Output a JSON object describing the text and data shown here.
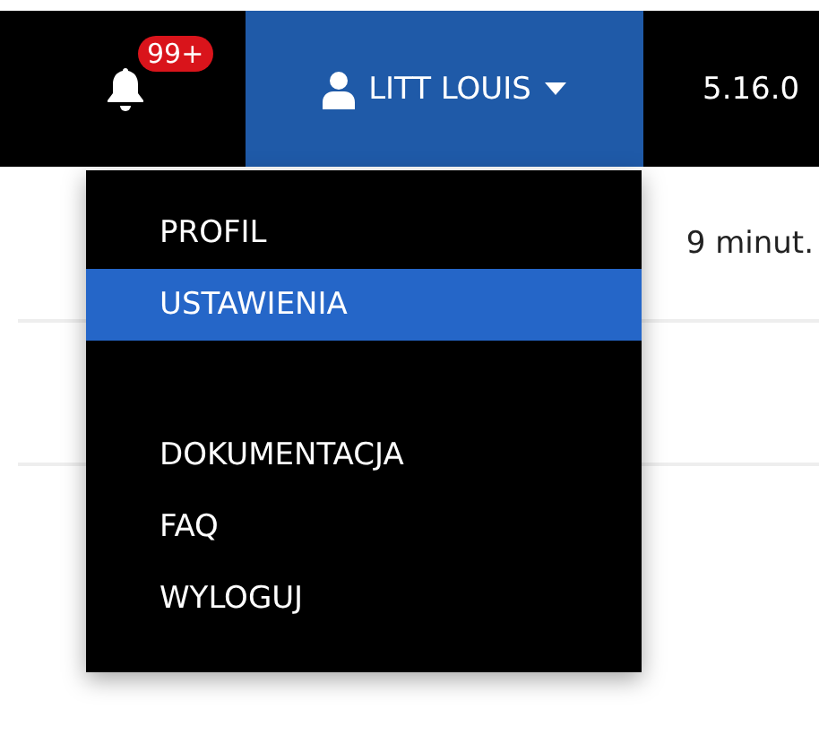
{
  "navbar": {
    "notifications": {
      "badge": "99+"
    },
    "user_menu": {
      "label": "LITT LOUIS",
      "expanded": true
    },
    "version": "5.16.0"
  },
  "background": {
    "text": "9 minut."
  },
  "dropdown": {
    "items": [
      {
        "label": "PROFIL",
        "selected": false
      },
      {
        "label": "USTAWIENIA",
        "selected": true
      },
      {
        "label": "DOKUMENTACJA",
        "selected": false,
        "separated": true
      },
      {
        "label": "FAQ",
        "selected": false
      },
      {
        "label": "WYLOGUJ",
        "selected": false
      }
    ]
  }
}
